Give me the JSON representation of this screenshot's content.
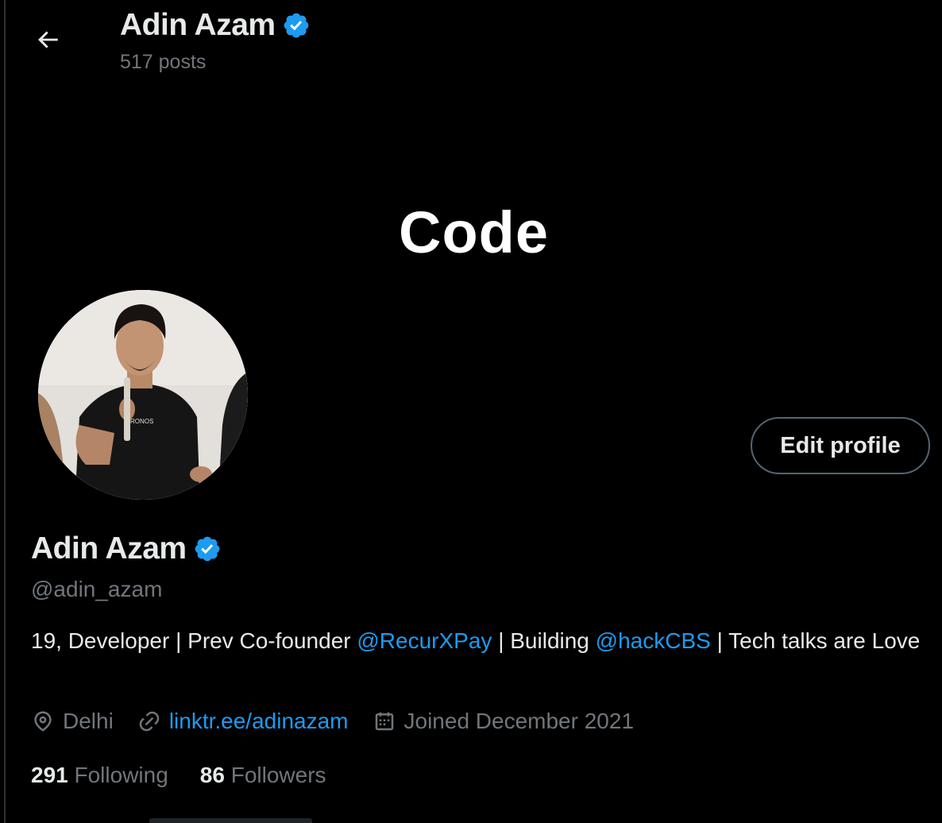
{
  "header": {
    "name": "Adin Azam",
    "posts": "517 posts"
  },
  "banner": {
    "text": "Code"
  },
  "profile": {
    "name": "Adin Azam",
    "handle": "@adin_azam",
    "edit_label": "Edit profile",
    "bio": {
      "part1": "19, Developer | Prev Co-founder ",
      "mention1": "@RecurXPay",
      "part2": " | Building ",
      "mention2": "@hackCBS",
      "part3": " | Tech talks are Love"
    },
    "location": "Delhi",
    "website": "linktr.ee/adinazam",
    "joined": "Joined December 2021"
  },
  "stats": {
    "following_count": "291",
    "following_label": "Following",
    "followers_count": "86",
    "followers_label": "Followers"
  },
  "colors": {
    "background": "#000000",
    "text": "#e7e9ea",
    "muted": "#71767b",
    "accent": "#1d9bf0",
    "verified": "#1d9bf0"
  },
  "icons": [
    "back-arrow-icon",
    "verified-badge-icon",
    "location-pin-icon",
    "link-icon",
    "calendar-icon"
  ]
}
